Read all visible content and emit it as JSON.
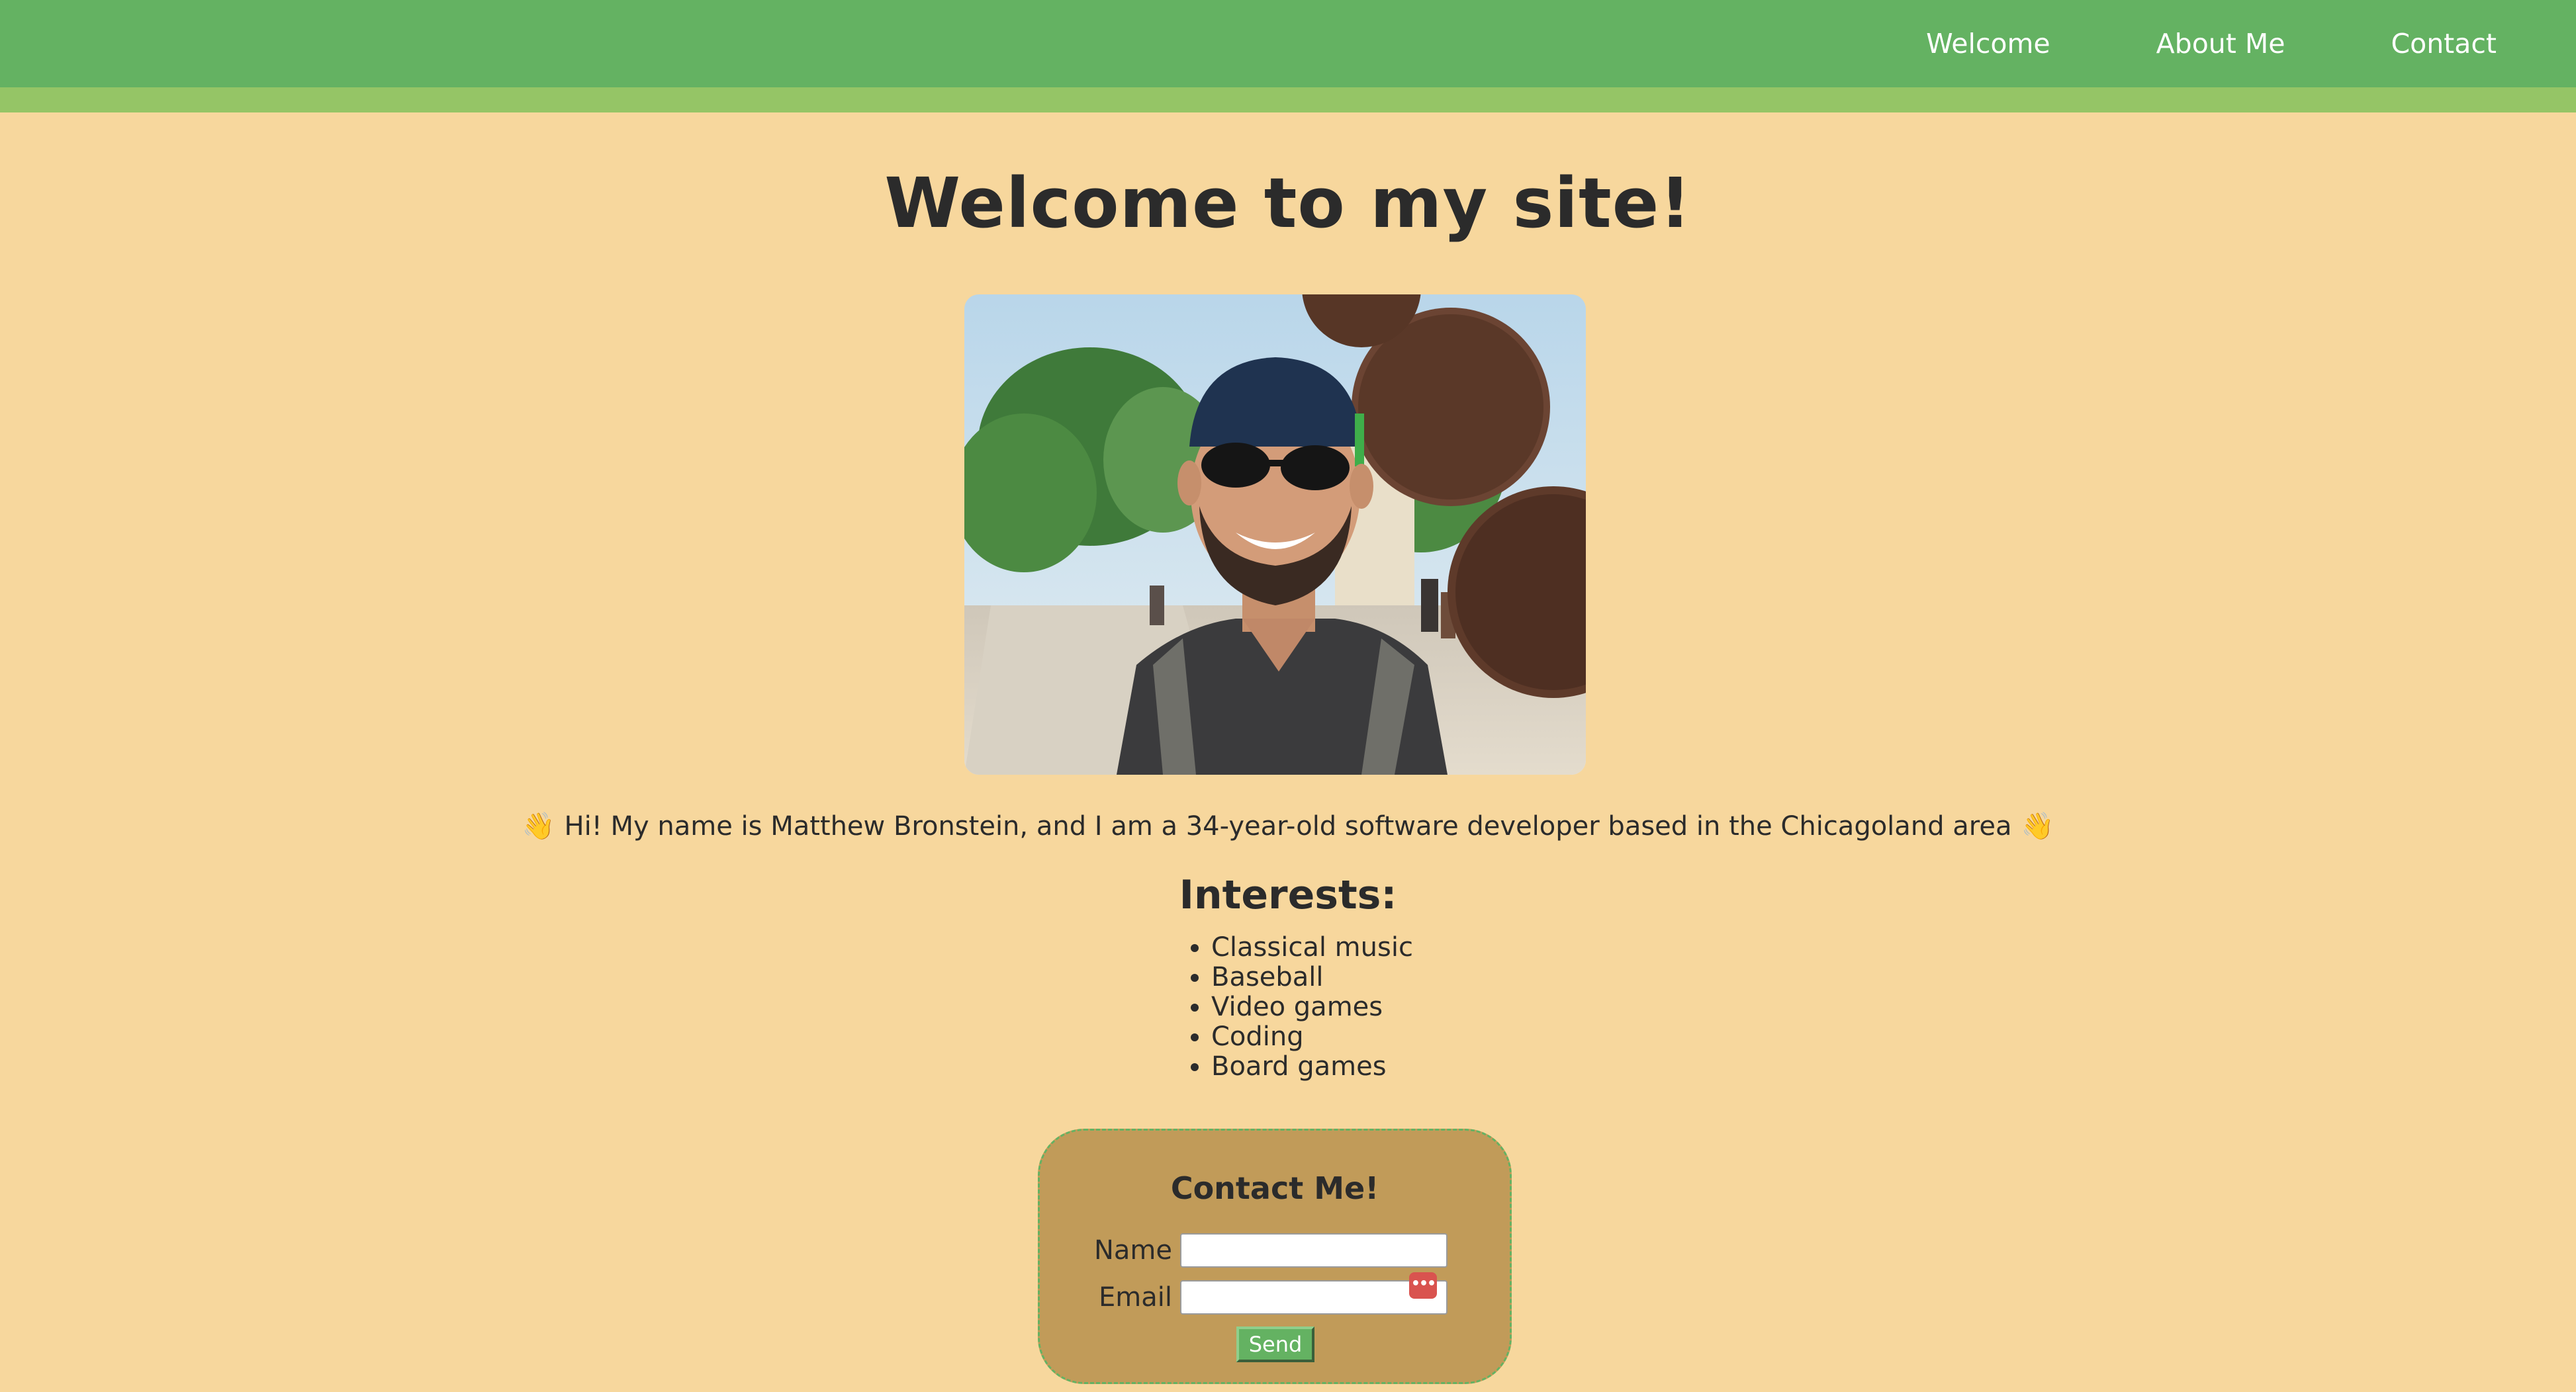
{
  "nav": {
    "items": [
      {
        "label": "Welcome"
      },
      {
        "label": "About Me"
      },
      {
        "label": "Contact"
      }
    ],
    "bar_color": "#64b262",
    "strip_color": "#95c566"
  },
  "hero": {
    "title": "Welcome to my site!",
    "photo_icon": "profile-photo"
  },
  "intro": {
    "wave_emoji": "👋",
    "text": "Hi! My name is Matthew Bronstein, and I am a 34-year-old software developer based in the Chicagoland area"
  },
  "interests": {
    "heading": "Interests:",
    "items": [
      "Classical music",
      "Baseball",
      "Video games",
      "Coding",
      "Board games"
    ]
  },
  "contact": {
    "title": "Contact Me!",
    "name_label": "Name",
    "name_value": "",
    "email_label": "Email",
    "email_value": "",
    "password_manager_icon": "password-manager-icon",
    "send_label": "Send"
  },
  "colors": {
    "background": "#f7d79d",
    "card": "#c19b59",
    "accent": "#64b262",
    "text": "#2b2b2b"
  }
}
